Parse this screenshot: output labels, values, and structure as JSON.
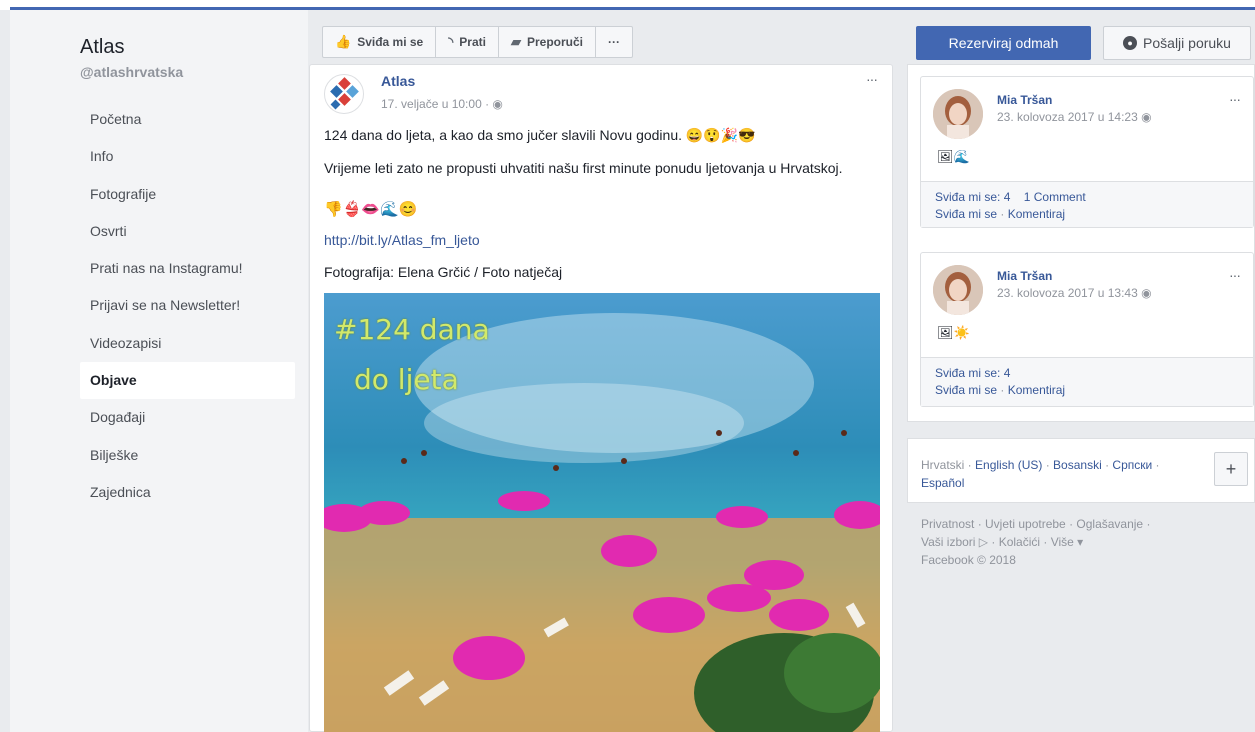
{
  "page": {
    "name": "Atlas",
    "handle": "@atlashrvatska"
  },
  "nav": {
    "items": [
      {
        "label": "Početna"
      },
      {
        "label": "Info"
      },
      {
        "label": "Fotografije"
      },
      {
        "label": "Osvrti"
      },
      {
        "label": "Prati nas na Instagramu!"
      },
      {
        "label": "Prijavi se na Newsletter!"
      },
      {
        "label": "Videozapisi"
      },
      {
        "label": "Objave",
        "active": true
      },
      {
        "label": "Događaji"
      },
      {
        "label": "Bilješke"
      },
      {
        "label": "Zajednica"
      }
    ]
  },
  "actions": {
    "like": "Sviđa mi se",
    "follow": "Prati",
    "recommend": "Preporuči",
    "more": "···",
    "book": "Rezerviraj odmah",
    "message": "Pošalji poruku"
  },
  "post": {
    "author": "Atlas",
    "time": "17. veljače u 10:00 · ",
    "more": "···",
    "text1": "124 dana do ljeta, a kao da smo jučer slavili Novu godinu. 😄😲🎉😎",
    "text2": "Vrijeme leti zato ne propusti uhvatiti našu first minute ponudu ljetovanja u Hrvatskoj.",
    "text3": "👎👙👄🌊😊",
    "link": "http://bit.ly/Atlas_fm_ljeto",
    "credit": "Fotografija: Elena Grčić / Foto natječaj",
    "image_caption_1": "#124 dana",
    "image_caption_2": "do ljeta"
  },
  "comments": [
    {
      "name": "Mia Tršan",
      "time": "23. kolovoza 2017 u 14:23 ",
      "icons": "🖼🌊",
      "likes": "Sviđa mi se: 4",
      "comments": "1 Comment",
      "like_action": "Sviđa mi se",
      "comment_action": "Komentiraj",
      "more": "···"
    },
    {
      "name": "Mia Tršan",
      "time": "23. kolovoza 2017 u 13:43 ",
      "icons": "🖼☀️",
      "likes": "Sviđa mi se: 4",
      "comments": "",
      "like_action": "Sviđa mi se",
      "comment_action": "Komentiraj",
      "more": "···"
    }
  ],
  "languages": {
    "current": "Hrvatski",
    "items": [
      "English (US)",
      "Bosanski",
      "Српски",
      "Español"
    ],
    "plus": "+"
  },
  "footer": {
    "line1": "Privatnost · Uvjeti upotrebe · Oglašavanje ·",
    "line2": "Vaši izbori ▷ · Kolačići · Više ▾",
    "line3": "Facebook © 2018"
  },
  "colors": {
    "brand": "#4267b2",
    "link": "#385898",
    "background": "#e9ebee"
  }
}
